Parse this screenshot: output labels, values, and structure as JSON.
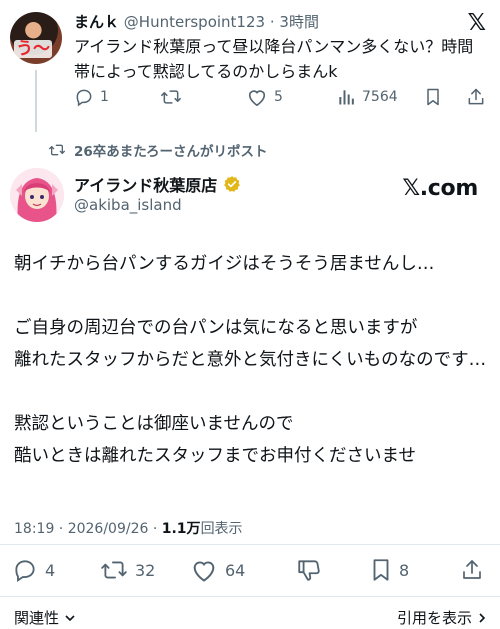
{
  "quoted_post": {
    "avatar_badge": "う〜",
    "name": "まんｋ",
    "handle": "@Hunterspoint123",
    "separator": "·",
    "time": "3時間",
    "text": "アイランド秋葉原って昼以降台パンマン多くない？時間帯によって黙認してるのかしらまんk",
    "replies": "1",
    "reposts": "",
    "likes": "5",
    "views": "7564"
  },
  "repost_notice": "26卒あまたろーさんがリポスト",
  "main_post": {
    "name": "アイランド秋葉原店",
    "handle": "@akiba_island",
    "brand": "𝕏.com",
    "paragraphs": [
      "朝イチから台パンするガイジはそうそう居ませんし…",
      "ご自身の周辺台での台パンは気になると思いますが\n離れたスタッフからだと意外と気付きにくいものなのです…",
      "黙認ということは御座いませんので\n酷いときは離れたスタッフまでお申付くださいませ"
    ],
    "timestamp": "18:19 · 2026/09/26 · ",
    "views_count": "1.1万",
    "views_label": "回表示",
    "replies": "4",
    "reposts": "32",
    "likes": "64",
    "bookmarks": "8"
  },
  "footer": {
    "related_label": "関連性",
    "quotes_label": "引用を表示"
  },
  "colors": {
    "text": "#0f1419",
    "secondary": "#536471",
    "verified_gold": "#e2b719",
    "divider": "#e1e8ed"
  },
  "icons": [
    "x-logo-icon",
    "reply-icon",
    "repost-icon",
    "like-icon",
    "views-icon",
    "bookmark-icon",
    "share-icon",
    "dislike-icon",
    "verified-badge-icon",
    "chevron-down-icon",
    "chevron-right-icon"
  ]
}
